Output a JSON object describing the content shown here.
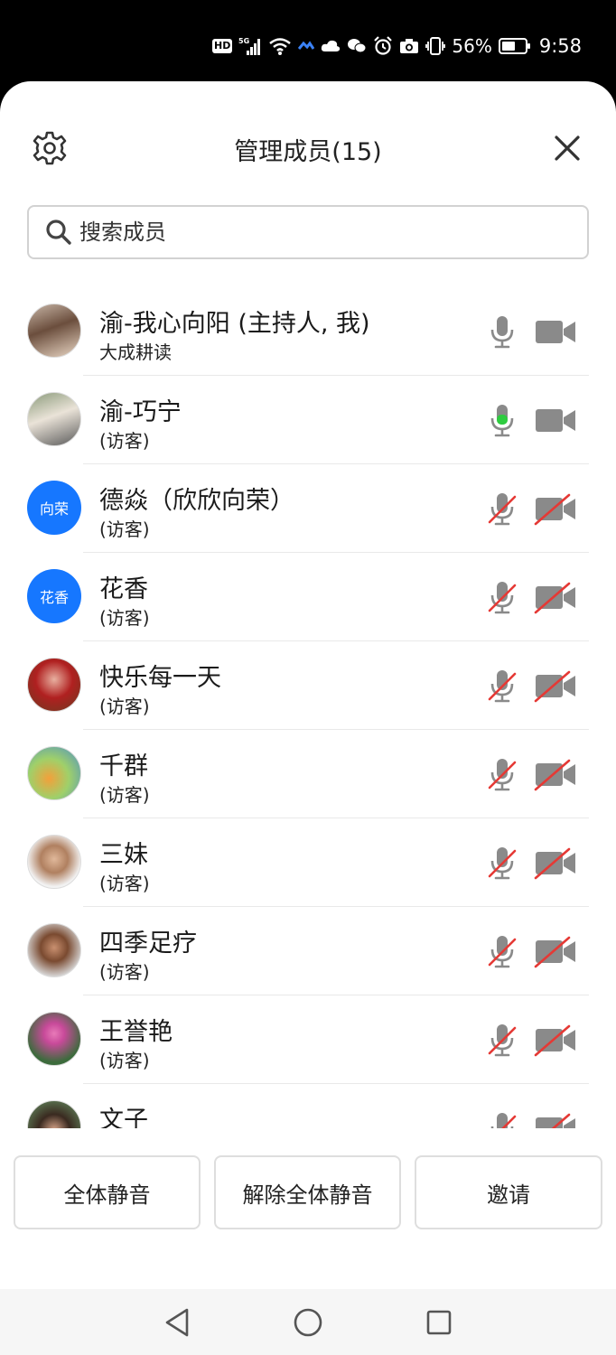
{
  "status_bar": {
    "hd": "HD",
    "network": "5G",
    "battery_percent": "56%",
    "time": "9:58"
  },
  "header": {
    "title": "管理成员(15)",
    "settings_icon": "gear-icon",
    "close_icon": "close-icon"
  },
  "search": {
    "placeholder": "搜索成员"
  },
  "members": [
    {
      "name": "渝-我心向阳 (主持人, 我)",
      "subtitle": "大成耕读",
      "avatar_type": "photo",
      "mic": "on",
      "camera": "off"
    },
    {
      "name": "渝-巧宁",
      "subtitle": "(访客)",
      "avatar_type": "photo",
      "mic": "speaking",
      "camera": "off"
    },
    {
      "name": "德焱（欣欣向荣）",
      "subtitle": "(访客)",
      "avatar_type": "text",
      "avatar_text": "向荣",
      "mic": "muted",
      "camera": "disabled"
    },
    {
      "name": "花香",
      "subtitle": "(访客)",
      "avatar_type": "text",
      "avatar_text": "花香",
      "mic": "muted",
      "camera": "disabled"
    },
    {
      "name": "快乐每一天",
      "subtitle": "(访客)",
      "avatar_type": "photo",
      "mic": "muted",
      "camera": "disabled"
    },
    {
      "name": "千群",
      "subtitle": "(访客)",
      "avatar_type": "photo",
      "mic": "muted",
      "camera": "disabled"
    },
    {
      "name": "三妹",
      "subtitle": "(访客)",
      "avatar_type": "photo",
      "mic": "muted",
      "camera": "disabled"
    },
    {
      "name": "四季足疗",
      "subtitle": "(访客)",
      "avatar_type": "photo",
      "mic": "muted",
      "camera": "disabled"
    },
    {
      "name": "王誉艳",
      "subtitle": "(访客)",
      "avatar_type": "photo",
      "mic": "muted",
      "camera": "disabled"
    },
    {
      "name": "文子",
      "subtitle": "",
      "avatar_type": "photo",
      "mic": "muted",
      "camera": "disabled"
    }
  ],
  "actions": {
    "mute_all": "全体静音",
    "unmute_all": "解除全体静音",
    "invite": "邀请"
  },
  "colors": {
    "accent_blue": "#1677ff",
    "speaking_green": "#2ecc40",
    "muted_red": "#e53935",
    "icon_gray": "#8a8a8a"
  }
}
